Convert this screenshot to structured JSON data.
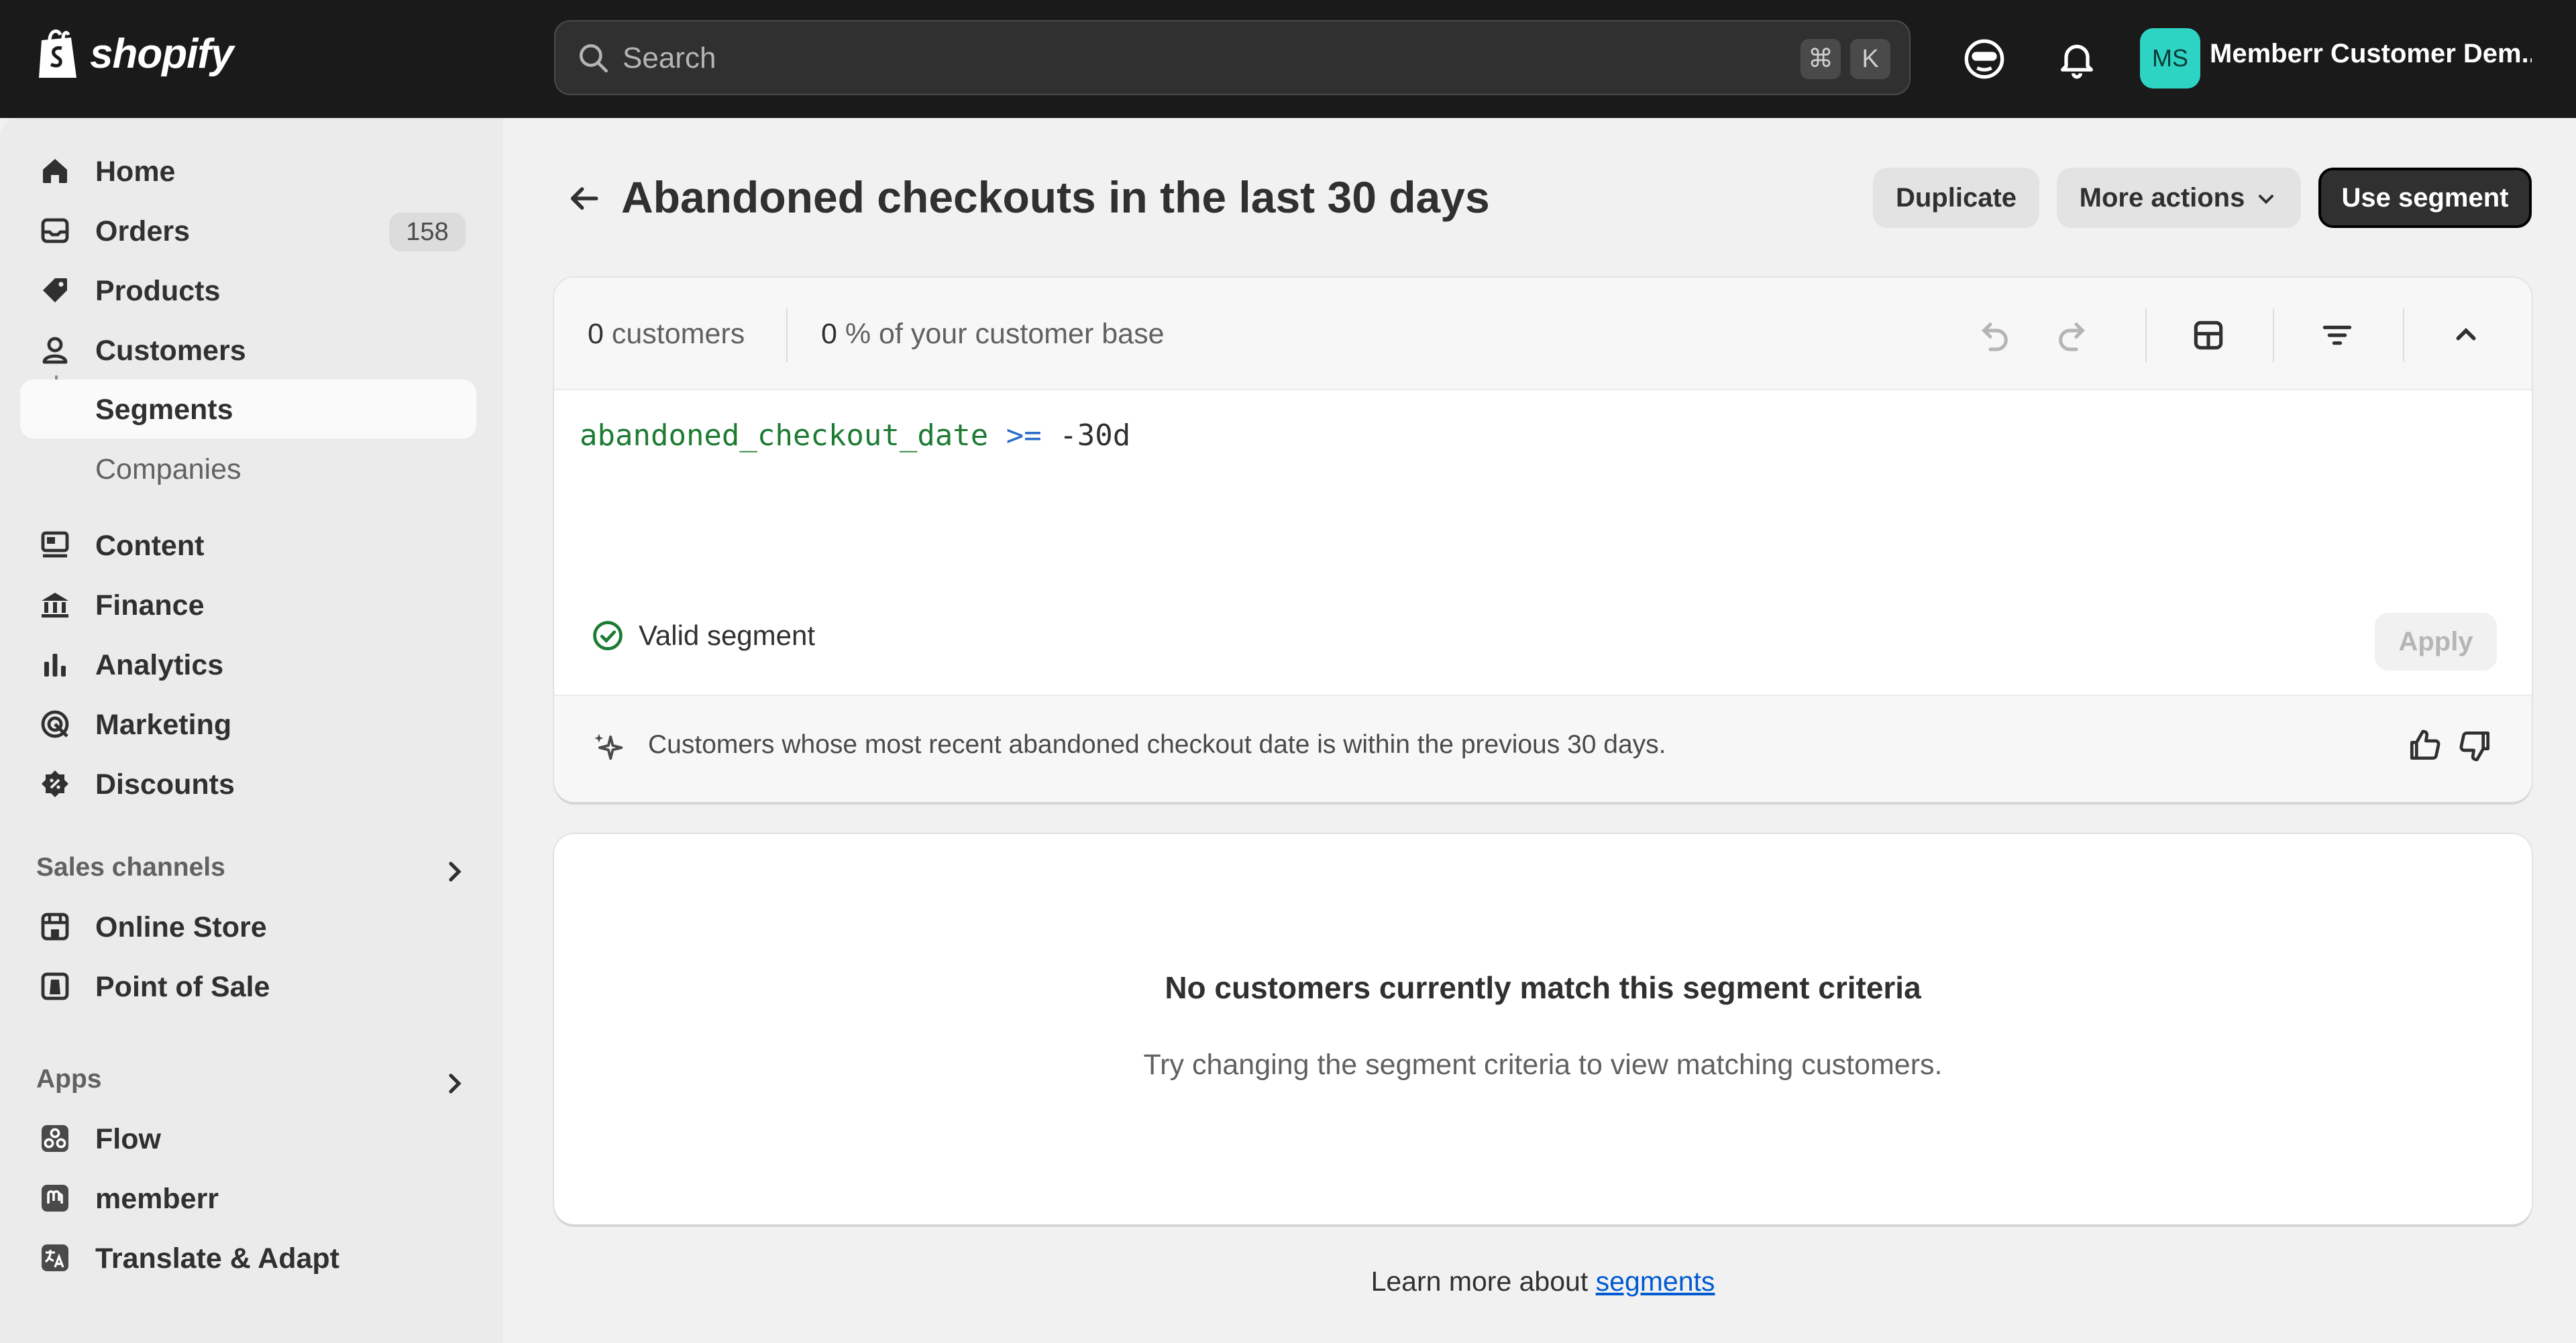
{
  "topbar": {
    "brand": "shopify",
    "search_placeholder": "Search",
    "shortcut_cmd": "⌘",
    "shortcut_key": "K",
    "avatar_initials": "MS",
    "store_name": "Memberr Customer Dem..."
  },
  "sidebar": {
    "items": [
      {
        "label": "Home",
        "icon": "home-icon"
      },
      {
        "label": "Orders",
        "icon": "orders-icon",
        "badge": "158"
      },
      {
        "label": "Products",
        "icon": "tag-icon"
      },
      {
        "label": "Customers",
        "icon": "person-icon"
      },
      {
        "label": "Segments"
      },
      {
        "label": "Companies"
      },
      {
        "label": "Content",
        "icon": "content-icon"
      },
      {
        "label": "Finance",
        "icon": "bank-icon"
      },
      {
        "label": "Analytics",
        "icon": "bar-chart-icon"
      },
      {
        "label": "Marketing",
        "icon": "target-icon"
      },
      {
        "label": "Discounts",
        "icon": "discount-icon"
      }
    ],
    "sales_channels": {
      "label": "Sales channels",
      "items": [
        {
          "label": "Online Store",
          "icon": "store-icon"
        },
        {
          "label": "Point of Sale",
          "icon": "pos-icon"
        }
      ]
    },
    "apps": {
      "label": "Apps",
      "items": [
        {
          "label": "Flow",
          "icon": "flow-icon"
        },
        {
          "label": "memberr",
          "icon": "memberr-icon"
        },
        {
          "label": "Translate & Adapt",
          "icon": "translate-icon"
        }
      ]
    }
  },
  "page": {
    "title": "Abandoned checkouts in the last 30 days",
    "duplicate_label": "Duplicate",
    "more_actions_label": "More actions",
    "use_segment_label": "Use segment"
  },
  "segment": {
    "customers_count": "0",
    "customers_label": "customers",
    "base_percent": "0",
    "base_label": "% of your customer base",
    "query_field": "abandoned_checkout_date",
    "query_operator": ">=",
    "query_value": "-30d",
    "status": "Valid segment",
    "apply_label": "Apply",
    "summary": "Customers whose most recent abandoned checkout date is within the previous 30 days."
  },
  "empty_state": {
    "title": "No customers currently match this segment criteria",
    "subtitle": "Try changing the segment criteria to view matching customers."
  },
  "footer": {
    "learn_prefix": "Learn more about",
    "learn_link": "segments"
  },
  "colors": {
    "topbar": "#1a1a1a",
    "avatar": "#2dd4c4",
    "query_field": "#1e7b34",
    "query_operator": "#2c6ecb",
    "valid_green": "#1e7b34",
    "link": "#005bd3"
  }
}
